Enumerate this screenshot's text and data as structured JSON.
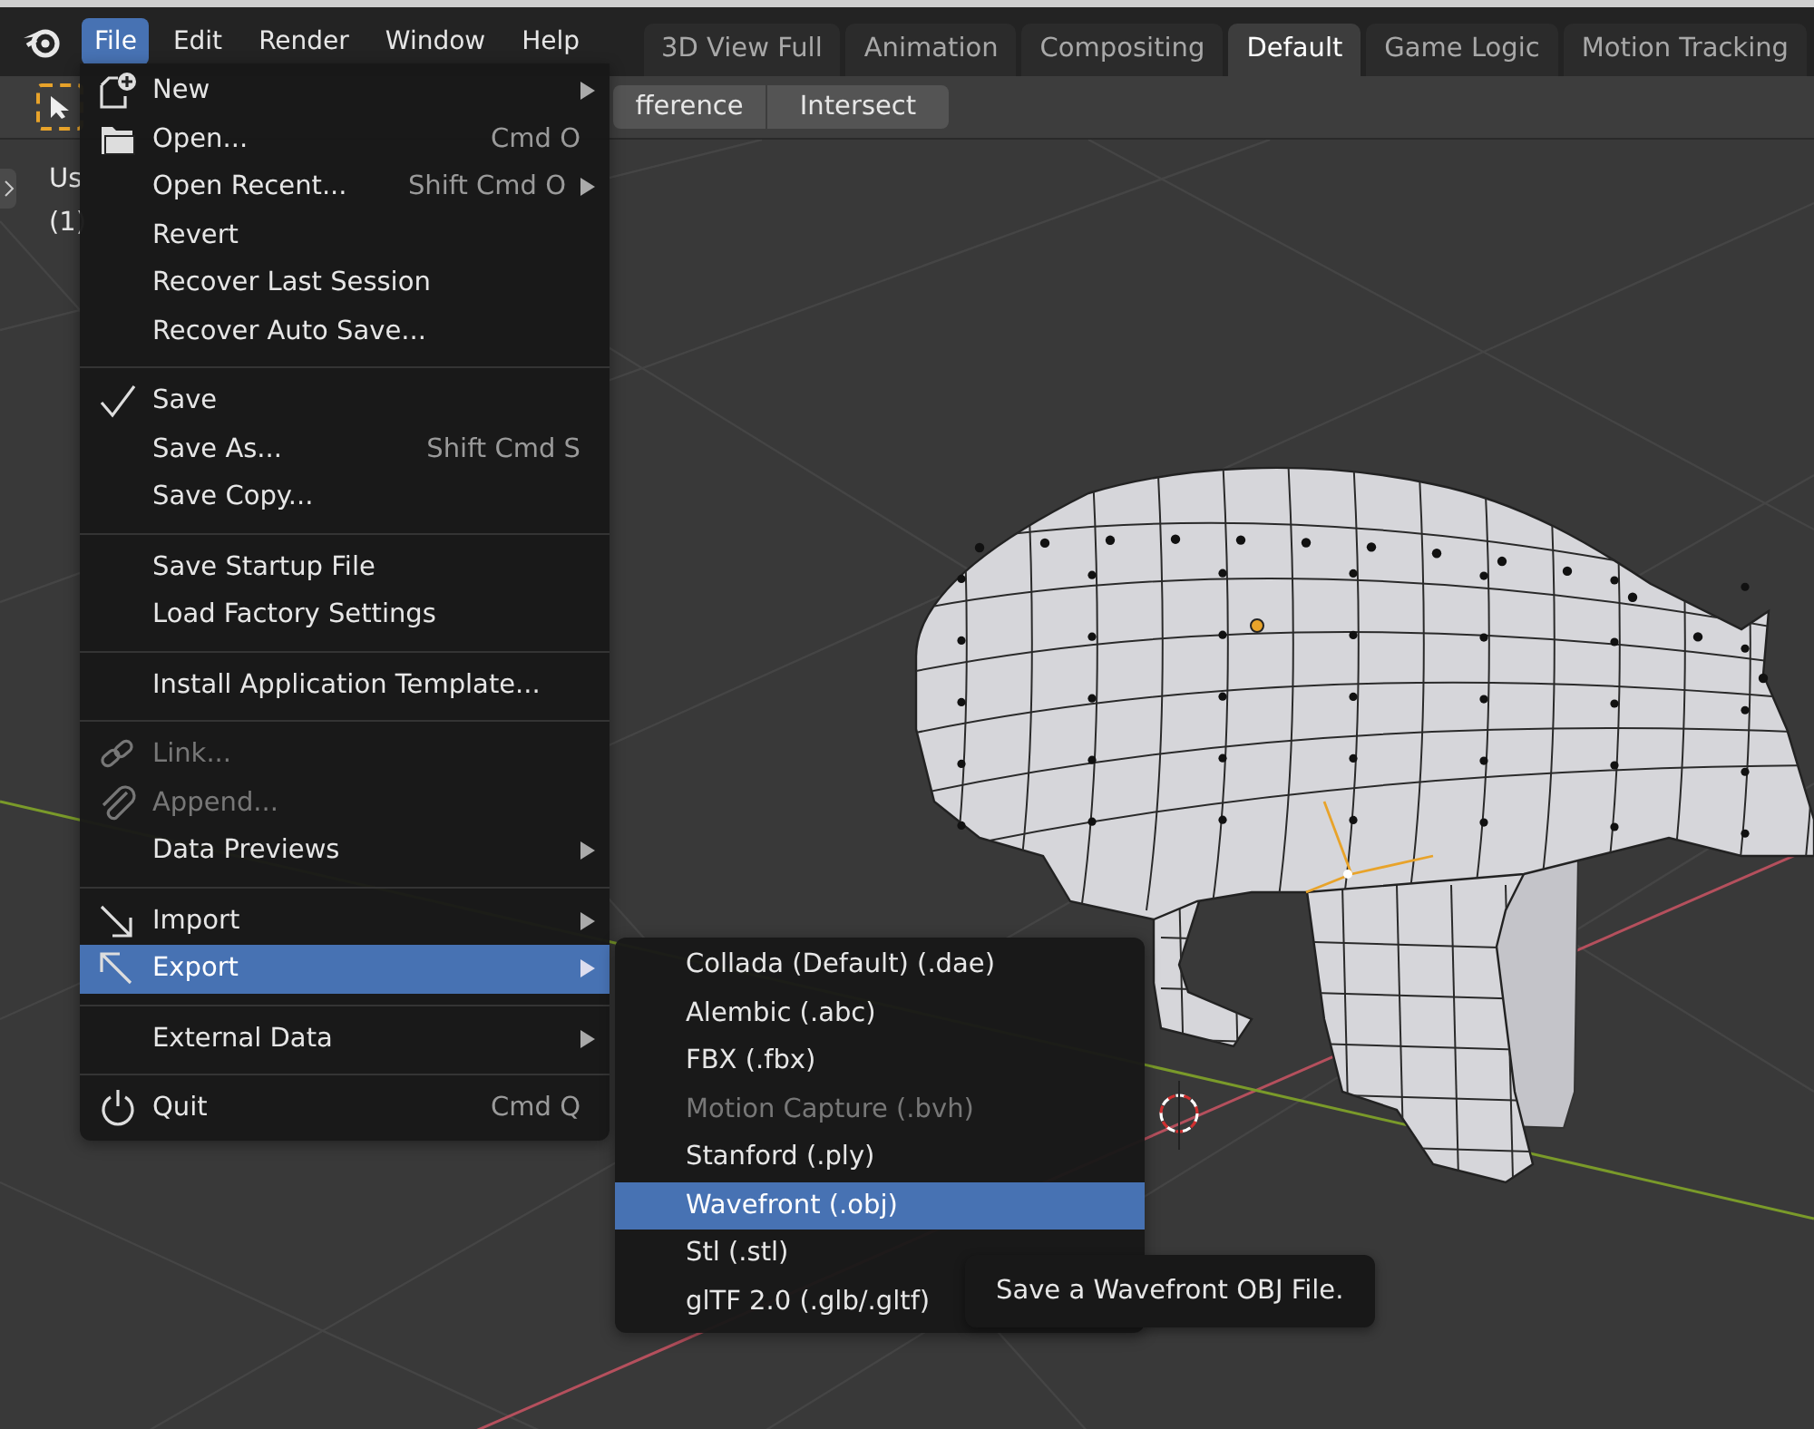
{
  "menubar": {
    "menus": [
      {
        "label": "File",
        "selected": true
      },
      {
        "label": "Edit",
        "selected": false
      },
      {
        "label": "Render",
        "selected": false
      },
      {
        "label": "Window",
        "selected": false
      },
      {
        "label": "Help",
        "selected": false
      }
    ]
  },
  "workspace_tabs": [
    {
      "label": "3D View Full",
      "selected": false
    },
    {
      "label": "Animation",
      "selected": false
    },
    {
      "label": "Compositing",
      "selected": false
    },
    {
      "label": "Default",
      "selected": true
    },
    {
      "label": "Game Logic",
      "selected": false
    },
    {
      "label": "Motion Tracking",
      "selected": false
    }
  ],
  "toolbar": {
    "buttons": [
      "fference",
      "Intersect"
    ]
  },
  "viewport": {
    "overlay": [
      "Us",
      "(1)"
    ]
  },
  "file_menu": {
    "groups": [
      [
        {
          "label": "New",
          "submenu": true,
          "disabled": false,
          "selected": false
        },
        {
          "label": "Open...",
          "shortcut": "Cmd O",
          "submenu": false,
          "disabled": false,
          "selected": false
        },
        {
          "label": "Open Recent...",
          "shortcut": "Shift Cmd O",
          "submenu": true,
          "disabled": false,
          "selected": false
        },
        {
          "label": "Revert",
          "submenu": false,
          "disabled": false,
          "selected": false
        },
        {
          "label": "Recover Last Session",
          "submenu": false,
          "disabled": false,
          "selected": false
        },
        {
          "label": "Recover Auto Save...",
          "submenu": false,
          "disabled": false,
          "selected": false
        }
      ],
      [
        {
          "label": "Save",
          "submenu": false,
          "disabled": false,
          "selected": false
        },
        {
          "label": "Save As...",
          "shortcut": "Shift Cmd S",
          "submenu": false,
          "disabled": false,
          "selected": false
        },
        {
          "label": "Save Copy...",
          "submenu": false,
          "disabled": false,
          "selected": false
        }
      ],
      [
        {
          "label": "Save Startup File",
          "submenu": false,
          "disabled": false,
          "selected": false
        },
        {
          "label": "Load Factory Settings",
          "submenu": false,
          "disabled": false,
          "selected": false
        }
      ],
      [
        {
          "label": "Install Application Template...",
          "submenu": false,
          "disabled": false,
          "selected": false
        }
      ],
      [
        {
          "label": "Link...",
          "submenu": false,
          "disabled": true,
          "selected": false
        },
        {
          "label": "Append...",
          "submenu": false,
          "disabled": true,
          "selected": false
        },
        {
          "label": "Data Previews",
          "submenu": true,
          "disabled": false,
          "selected": false
        }
      ],
      [
        {
          "label": "Import",
          "submenu": true,
          "disabled": false,
          "selected": false
        },
        {
          "label": "Export",
          "submenu": true,
          "disabled": false,
          "selected": true
        }
      ],
      [
        {
          "label": "External Data",
          "submenu": true,
          "disabled": false,
          "selected": false
        }
      ],
      [
        {
          "label": "Quit",
          "shortcut": "Cmd Q",
          "submenu": false,
          "disabled": false,
          "selected": false
        }
      ]
    ]
  },
  "export_submenu": {
    "items": [
      {
        "label": "Collada (Default) (.dae)",
        "disabled": false,
        "selected": false
      },
      {
        "label": "Alembic (.abc)",
        "disabled": false,
        "selected": false
      },
      {
        "label": "FBX (.fbx)",
        "disabled": false,
        "selected": false
      },
      {
        "label": "Motion Capture (.bvh)",
        "disabled": true,
        "selected": false
      },
      {
        "label": "Stanford (.ply)",
        "disabled": false,
        "selected": false
      },
      {
        "label": "Wavefront (.obj)",
        "disabled": false,
        "selected": true
      },
      {
        "label": "Stl (.stl)",
        "disabled": false,
        "selected": false
      },
      {
        "label": "glTF 2.0 (.glb/.gltf)",
        "disabled": false,
        "selected": false
      }
    ]
  },
  "tooltip": "Save a Wavefront OBJ File."
}
